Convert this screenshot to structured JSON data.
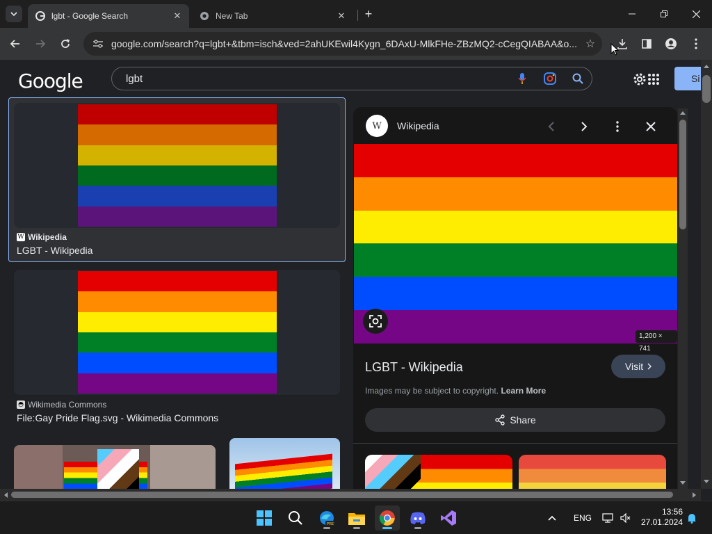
{
  "browser": {
    "tabs": [
      {
        "title": "lgbt - Google Search",
        "active": true
      },
      {
        "title": "New Tab",
        "active": false
      }
    ],
    "new_tab_label": "+",
    "url": "google.com/search?q=lgbt+&tbm=isch&ved=2ahUKEwil4Kygn_6DAxU-MlkFHe-ZBzMQ2-cCegQIABAA&o..."
  },
  "google": {
    "logo": "Google",
    "query": "lgbt",
    "signin_label": "Si"
  },
  "results": [
    {
      "source": "Wikipedia",
      "title": "LGBT - Wikipedia",
      "stripes": [
        "#c00000",
        "#d46a00",
        "#d4b300",
        "#006b1f",
        "#1a3fb0",
        "#5a147a"
      ]
    },
    {
      "source": "Wikimedia Commons",
      "title": "File:Gay Pride Flag.svg - Wikimedia Commons",
      "stripes": [
        "#e50000",
        "#ff8c00",
        "#ffed00",
        "#008026",
        "#004dff",
        "#750787"
      ]
    }
  ],
  "panel": {
    "source": "Wikipedia",
    "source_logo": "W",
    "image_dims": "1,200 × 741",
    "title": "LGBT - Wikipedia",
    "visit_label": "Visit",
    "copyright_text": "Images may be subject to copyright.",
    "learn_more": "Learn More",
    "share_label": "Share",
    "stripes": [
      "#e50000",
      "#ff8c00",
      "#ffed00",
      "#008026",
      "#004dff",
      "#750787"
    ]
  },
  "taskbar": {
    "language": "ENG",
    "time": "13:56",
    "date": "27.01.2024"
  },
  "colors": {
    "accent": "#8ab4f8",
    "background": "#202124",
    "visit_button": "#394457"
  }
}
